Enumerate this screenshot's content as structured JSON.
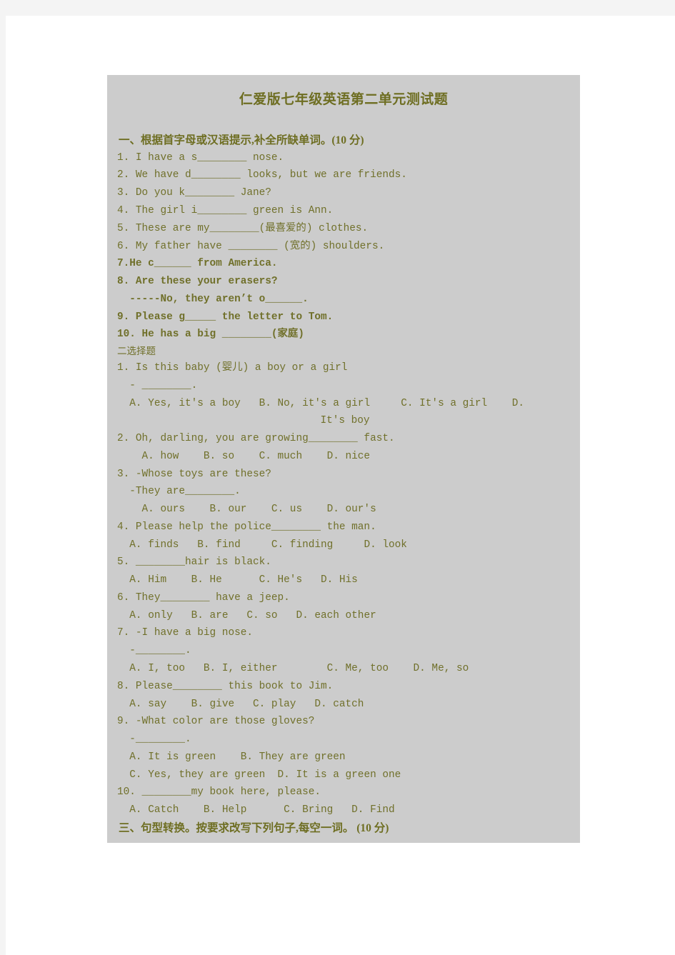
{
  "document": {
    "title": "仁爱版七年级英语第二单元测试题",
    "text_color": "#70702a",
    "block_bg": "#cccccc",
    "page_bg": "#ffffff",
    "canvas_bg": "#f4f4f4"
  },
  "section_one": {
    "heading": "一、根据首字母或汉语提示,补全所缺单词。(10 分)",
    "items": [
      "1. I have a s________ nose.",
      "2. We have d________ looks, but we are friends.",
      "3. Do you k________ Jane?",
      "4. The girl i________ green is Ann.",
      "5. These are my________(最喜爱的) clothes.",
      "6. My father have ________ (宽的) shoulders.",
      "7.He c______ from America.",
      "8. Are these your erasers?",
      "  -----No, they aren’t o______.",
      "9. Please g_____ the letter to Tom.",
      "10. He has a big ________(家庭)"
    ],
    "bold_from_index": 6
  },
  "section_two": {
    "heading": "二选择题",
    "questions": [
      {
        "lines": [
          "1. Is this baby (婴儿) a boy or a girl",
          "  - ________.",
          "  A. Yes, it's a boy   B. No, it's a girl     C. It's a girl    D."
        ],
        "center_line": "It's boy"
      },
      {
        "lines": [
          "2. Oh, darling, you are growing________ fast.",
          "    A. how    B. so    C. much    D. nice"
        ]
      },
      {
        "lines": [
          "3. -Whose toys are these?",
          "  -They are________.",
          "    A. ours    B. our    C. us    D. our's"
        ]
      },
      {
        "lines": [
          "4. Please help the police________ the man.",
          "  A. finds   B. find     C. finding     D. look"
        ]
      },
      {
        "lines": [
          "5. ________hair is black.",
          "  A. Him    B. He      C. He's   D. His"
        ]
      },
      {
        "lines": [
          "6. They________ have a jeep.",
          "  A. only   B. are   C. so   D. each other"
        ]
      },
      {
        "lines": [
          "7. -I have a big nose.",
          "  -________.",
          "  A. I, too   B. I, either        C. Me, too    D. Me, so"
        ]
      },
      {
        "lines": [
          "8. Please________ this book to Jim.",
          "  A. say    B. give   C. play   D. catch"
        ]
      },
      {
        "lines": [
          "9. -What color are those gloves?",
          "  -________.",
          "  A. It is green    B. They are green",
          "  C. Yes, they are green  D. It is a green one"
        ]
      },
      {
        "lines": [
          "10. ________my book here, please.",
          "  A. Catch    B. Help      C. Bring   D. Find"
        ]
      }
    ]
  },
  "section_three": {
    "heading": "三、句型转换。按要求改写下列句子,每空一词。 (10 分)"
  }
}
